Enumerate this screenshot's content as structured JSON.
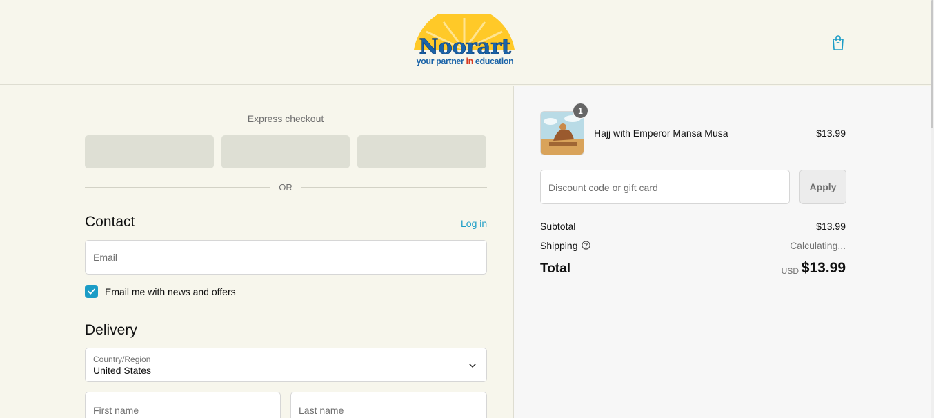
{
  "header": {
    "logo": {
      "name": "Noorart",
      "tagline_part1": "your partner ",
      "tagline_part2": "in",
      "tagline_part3": " education"
    },
    "cart_icon": "shopping-bag-icon"
  },
  "express": {
    "label": "Express checkout",
    "or_label": "OR"
  },
  "contact": {
    "title": "Contact",
    "login_link": "Log in",
    "email_placeholder": "Email",
    "newsletter_label": "Email me with news and offers",
    "newsletter_checked": true
  },
  "delivery": {
    "title": "Delivery",
    "country_label": "Country/Region",
    "country_value": "United States",
    "first_name_placeholder": "First name",
    "last_name_placeholder": "Last name"
  },
  "order": {
    "item": {
      "name": "Hajj with Emperor Mansa Musa",
      "price": "$13.99",
      "quantity": "1"
    },
    "discount_placeholder": "Discount code or gift card",
    "apply_label": "Apply",
    "subtotal_label": "Subtotal",
    "subtotal_value": "$13.99",
    "shipping_label": "Shipping",
    "shipping_value": "Calculating...",
    "total_label": "Total",
    "total_currency": "USD",
    "total_value": "$13.99"
  },
  "colors": {
    "accent": "#1b9cc6",
    "page_bg": "#f7f6ec",
    "summary_bg": "#f7f7f7"
  }
}
